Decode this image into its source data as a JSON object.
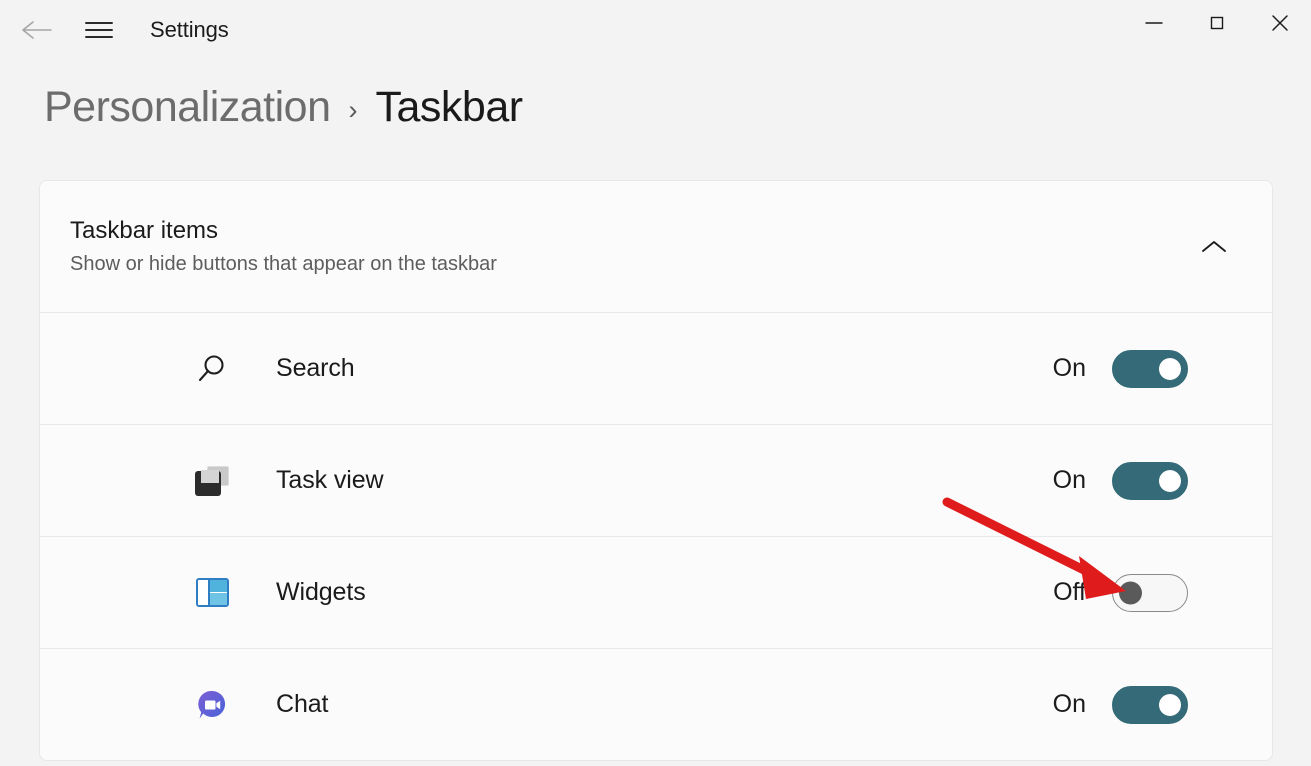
{
  "window": {
    "title": "Settings",
    "back_icon": "back-arrow-icon",
    "menu_icon": "hamburger-menu-icon",
    "controls": {
      "minimize": "minimize-icon",
      "maximize": "maximize-icon",
      "close": "close-icon"
    }
  },
  "breadcrumb": {
    "parent": "Personalization",
    "separator": "›",
    "current": "Taskbar"
  },
  "card": {
    "title": "Taskbar items",
    "subtitle": "Show or hide buttons that appear on the taskbar",
    "collapse_icon": "chevron-up-icon",
    "rows": [
      {
        "icon": "search-icon",
        "label": "Search",
        "state": "On",
        "on": true
      },
      {
        "icon": "task-view-icon",
        "label": "Task view",
        "state": "On",
        "on": true
      },
      {
        "icon": "widgets-icon",
        "label": "Widgets",
        "state": "Off",
        "on": false
      },
      {
        "icon": "chat-icon",
        "label": "Chat",
        "state": "On",
        "on": true
      }
    ]
  },
  "annotation": {
    "type": "red-arrow",
    "color": "#e01b1b",
    "points_to": "widgets-toggle"
  },
  "colors": {
    "background": "#f3f3f3",
    "card": "#fbfbfb",
    "toggle_on": "#356b78",
    "toggle_off_border": "#8a8a8a",
    "text_primary": "#1b1b1b",
    "text_secondary": "#5d5d5d",
    "accent_red": "#e01b1b"
  }
}
